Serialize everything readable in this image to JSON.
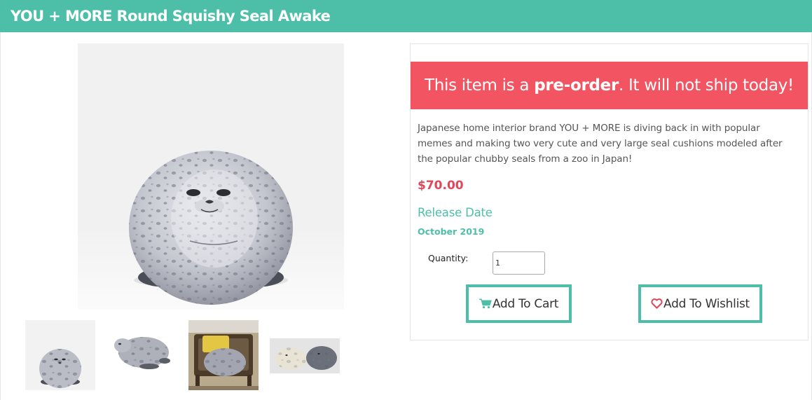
{
  "product": {
    "title": "YOU + MORE Round Squishy Seal Awake"
  },
  "banner": {
    "prefix": "This item is a ",
    "emphasis": "pre-order",
    "suffix": ". It will not ship today!",
    "color": "#f25462"
  },
  "details": {
    "description": "Japanese home interior brand YOU + MORE is diving back in with popular memes and making two very cute and very large seal cushions modeled after the popular chubby seals from a zoo in Japan!",
    "price": "$70.00",
    "release_heading": "Release Date",
    "release_date": "October 2019"
  },
  "purchase": {
    "quantity_label": "Quantity:",
    "quantity_value": "1",
    "add_to_cart_label": "Add To Cart",
    "add_to_cart_icon": "cart-icon",
    "add_to_wishlist_label": "Add To Wishlist",
    "add_to_wishlist_icon": "heart-icon"
  },
  "theme": {
    "accent": "#4dbfa8",
    "price_color": "#e0475a"
  }
}
